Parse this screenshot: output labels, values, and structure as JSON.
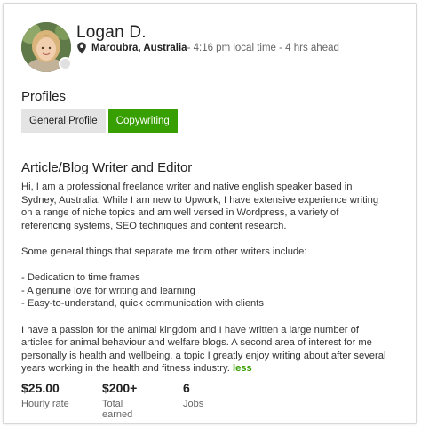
{
  "freelancer": {
    "name": "Logan D.",
    "location": "Maroubra, Australia",
    "local_time": " - 4:16 pm local time - 4 hrs ahead"
  },
  "profiles": {
    "title": "Profiles",
    "tabs": [
      {
        "label": "General Profile",
        "active": false
      },
      {
        "label": "Copywriting",
        "active": true
      }
    ]
  },
  "profile": {
    "headline": "Article/Blog Writer and Editor",
    "description": [
      "Hi, I am a professional freelance writer and native english speaker based in Sydney, Australia. While I am new to Upwork, I have extensive experience writing on a range of niche topics and am well versed in Wordpress, a variety of referencing systems, SEO techniques and content research.",
      "Some general things that separate me from other writers include:",
      "- Dedication to time frames",
      "- A genuine love for writing and learning",
      "- Easy-to-understand, quick communication with clients",
      "I have a passion for the animal kingdom and I have written a large number of articles for animal behaviour and welfare blogs. A second area of interest for me personally is health and wellbeing, a topic I greatly enjoy writing about after several years working in the health and fitness industry."
    ],
    "less_label": "less"
  },
  "stats": {
    "hourly_rate": {
      "value": "$25.00",
      "label": "Hourly rate"
    },
    "total_earned": {
      "value": "$200+",
      "label": "Total earned"
    },
    "jobs": {
      "value": "6",
      "label": "Jobs"
    }
  },
  "colors": {
    "accent": "#37a000",
    "tab_inactive": "#e4e4e4",
    "status_dot": "#e0e0e0"
  },
  "icons": {
    "location": "map-pin-icon"
  }
}
